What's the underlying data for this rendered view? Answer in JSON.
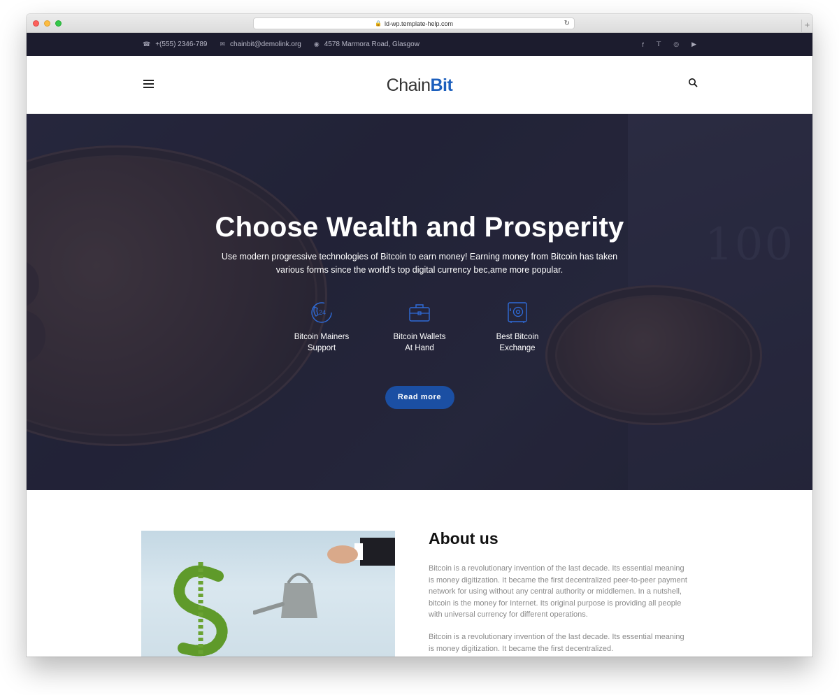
{
  "browser": {
    "url": "ld-wp.template-help.com"
  },
  "topbar": {
    "phone": "+(555) 2346-789",
    "email": "chainbit@demolink.org",
    "address": "4578 Marmora Road, Glasgow",
    "social": [
      "facebook-icon",
      "twitter-icon",
      "instagram-icon",
      "youtube-icon"
    ]
  },
  "header": {
    "logo_part1": "Chain",
    "logo_part2": "Bit"
  },
  "hero": {
    "title": "Choose Wealth and Prosperity",
    "text": "Use modern progressive technologies of Bitcoin to earn money! Earning money from Bitcoin has taken various forms since the world’s top digital currency bec,ame more popular.",
    "features": [
      {
        "line1": "Bitcoin Mainers",
        "line2": "Support",
        "icon": "support-24-icon"
      },
      {
        "line1": "Bitcoin Wallets",
        "line2": "At Hand",
        "icon": "wallet-icon"
      },
      {
        "line1": "Best Bitcoin",
        "line2": "Exchange",
        "icon": "safe-icon"
      }
    ],
    "button": "Read more"
  },
  "about": {
    "title": "About us",
    "p1": "Bitcoin is a revolutionary invention of the last decade. Its essential meaning is money digitization. It became the first decentralized peer-to-peer payment network for using without any central authority or middlemen. In a nutshell, bitcoin is the money for Internet. Its original purpose is providing all people with universal currency for different operations.",
    "p2": "Bitcoin is a revolutionary invention of the last decade. Its essential meaning is money digitization. It became the first decentralized."
  },
  "colors": {
    "accent": "#1c5fbd",
    "button": "#1b4fa3",
    "topbar": "#1c1c2e",
    "hero_overlay": "#1d1e34"
  }
}
